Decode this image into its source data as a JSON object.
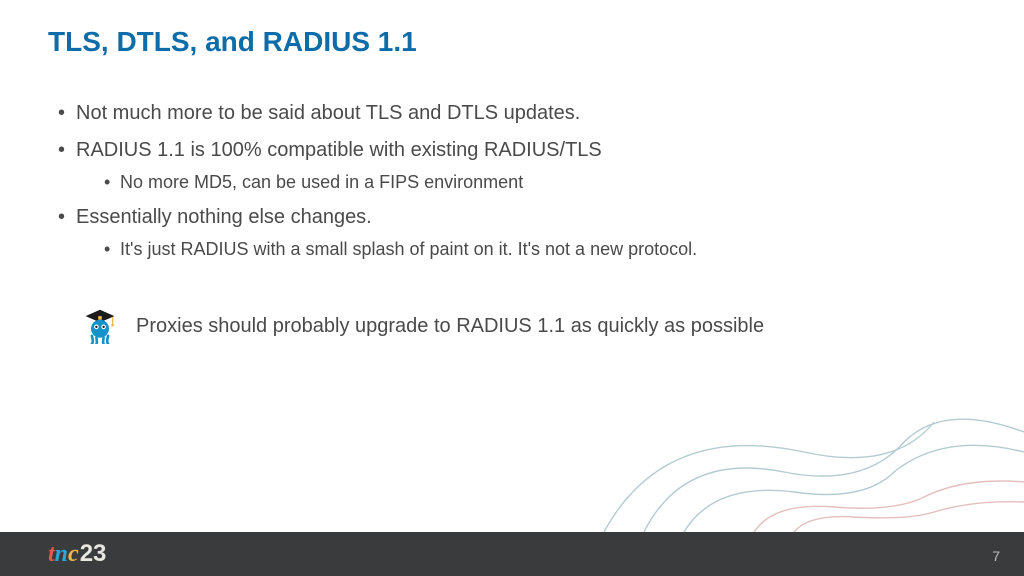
{
  "title": "TLS, DTLS, and RADIUS 1.1",
  "bullets": {
    "0": {
      "text": "Not much more to be said about TLS and DTLS updates."
    },
    "1": {
      "text": "RADIUS 1.1 is 100% compatible with existing RADIUS/TLS",
      "sub": {
        "0": "No more MD5, can be used in a FIPS environment"
      }
    },
    "2": {
      "text": "Essentially nothing else changes.",
      "sub": {
        "0": "It's just RADIUS with a small splash of paint on it.  It's not a new protocol."
      }
    }
  },
  "callout": {
    "icon_name": "mascot-grad-icon",
    "text": "Proxies should probably upgrade to RADIUS 1.1 as quickly as possible"
  },
  "footer": {
    "logo_letters": {
      "0": "t",
      "1": "n",
      "2": "c"
    },
    "logo_year": "23",
    "page_number": "7"
  }
}
